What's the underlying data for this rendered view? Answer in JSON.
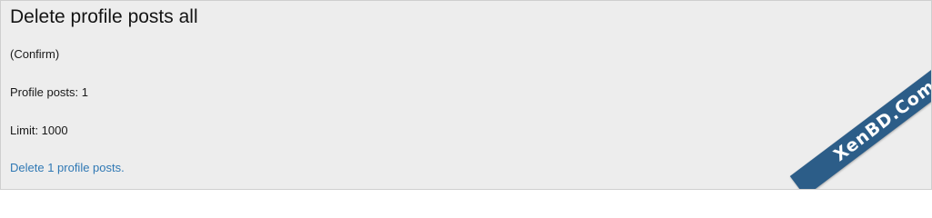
{
  "page": {
    "title": "Delete profile posts all",
    "confirm_text": "(Confirm)",
    "profile_posts_text": "Profile posts: 1",
    "limit_text": "Limit: 1000",
    "delete_link_text": "Delete 1 profile posts."
  },
  "watermark": {
    "text": "XenBD.Com"
  },
  "colors": {
    "background": "#ededed",
    "link": "#2f78b4",
    "ribbon": "#2c5d88"
  }
}
